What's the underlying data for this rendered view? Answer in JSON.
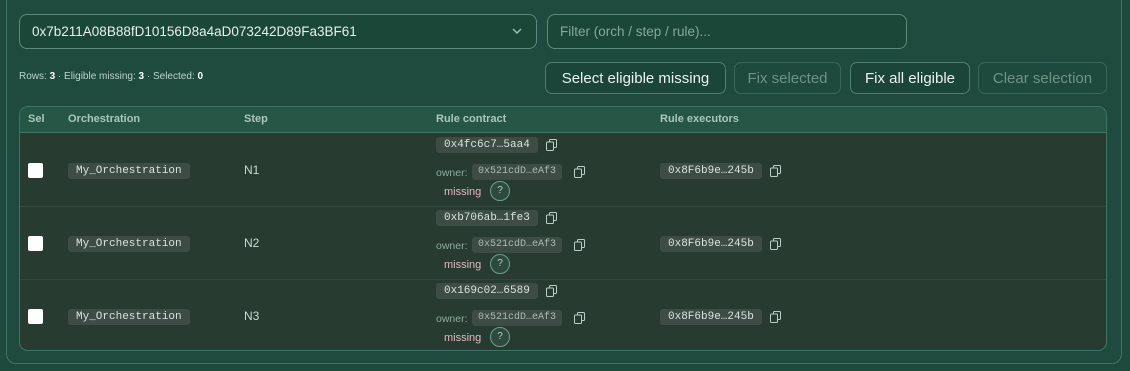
{
  "orchestrator_select": {
    "value": "0x7b211A08B88fD10156D8a4aD073242D89Fa3BF61"
  },
  "filter": {
    "placeholder": "Filter (orch / step / rule)..."
  },
  "summary": {
    "rows_label": "Rows:",
    "rows": "3",
    "eligible_label": "· Eligible missing:",
    "eligible": "3",
    "selected_label": "· Selected:",
    "selected": "0"
  },
  "buttons": {
    "select_eligible": "Select eligible missing",
    "fix_selected": "Fix selected",
    "fix_all": "Fix all eligible",
    "clear_selection": "Clear selection"
  },
  "table": {
    "headers": {
      "sel": "Sel",
      "orchestration": "Orchestration",
      "step": "Step",
      "rule_contract": "Rule contract",
      "rule_executors": "Rule executors"
    },
    "owner_label": "owner:",
    "missing_label": "missing",
    "help_label": "?",
    "rows": [
      {
        "orchestration": "My_Orchestration",
        "step": "N1",
        "rule_contract": "0x4fc6c7…5aa4",
        "owner": "0x521cdD…eAf3",
        "status": "missing",
        "executor": "0x8F6b9e…245b"
      },
      {
        "orchestration": "My_Orchestration",
        "step": "N2",
        "rule_contract": "0xb706ab…1fe3",
        "owner": "0x521cdD…eAf3",
        "status": "missing",
        "executor": "0x8F6b9e…245b"
      },
      {
        "orchestration": "My_Orchestration",
        "step": "N3",
        "rule_contract": "0x169c02…6589",
        "owner": "0x521cdD…eAf3",
        "status": "missing",
        "executor": "0x8F6b9e…245b"
      }
    ]
  },
  "icons": {
    "copy": "copy-icon",
    "chevron": "chevron-down-icon"
  },
  "colors": {
    "background": "#1d4a3c",
    "missing_text": "#e2b7c2",
    "chip_bg": "#3d4c44"
  }
}
